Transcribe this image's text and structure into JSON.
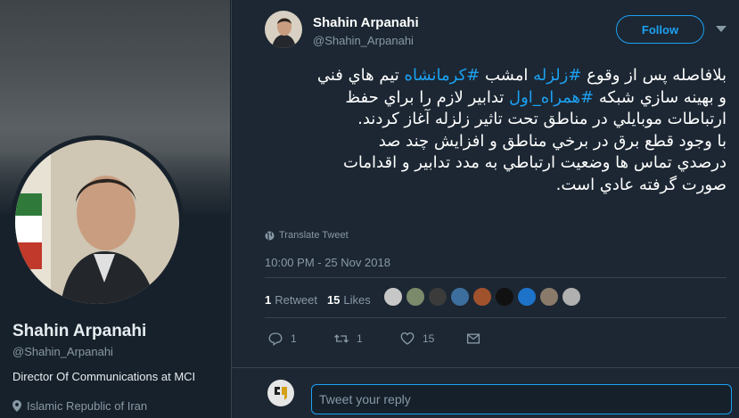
{
  "profile": {
    "name": "Shahin Arpanahi",
    "handle": "@Shahin_Arpanahi",
    "bio": "Director Of Communications at MCI",
    "location": "Islamic Republic of Iran"
  },
  "tweet": {
    "author_name": "Shahin Arpanahi",
    "author_handle": "@Shahin_Arpanahi",
    "follow_label": "Follow",
    "text": {
      "l1_a": "بلافاصله پس از وقوع ",
      "l1_tag1": "#زلزله",
      "l1_b": " امشب ",
      "l1_tag2": "#كرمانشاه",
      "l1_c": " تيم هاي فني",
      "l2_a": "و بهينه سازي شبكه ",
      "l2_tag": "#همراه_اول",
      "l2_b": " تدابير لازم را براي حفظ",
      "l3": "ارتباطات موبايلي در مناطق تحت تاثير زلزله آغاز كردند.",
      "l4": "با وجود قطع برق در برخي مناطق و افزايش چند صد",
      "l5": "درصدي تماس ها وضعيت ارتباطي به مدد تدابير و اقدامات",
      "l6": "صورت گرفته عادي است."
    },
    "translate_label": "Translate Tweet",
    "timestamp": "10:00 PM - 25 Nov 2018",
    "retweet_count": "1",
    "retweet_label": "Retweet",
    "like_count": "15",
    "like_label": "Likes",
    "actions": {
      "reply_count": "1",
      "retweet_count": "1",
      "like_count": "15"
    },
    "reply_placeholder": "Tweet your reply",
    "liker_colors": [
      "#c7c7c7",
      "#7a8a6a",
      "#3b3b3b",
      "#3d6f9e",
      "#a0522d",
      "#111111",
      "#1d73c9",
      "#8a7a6a",
      "#b0b0b0"
    ]
  },
  "colors": {
    "accent": "#1da1f2",
    "background": "#1c2733",
    "muted": "#8899a6"
  }
}
